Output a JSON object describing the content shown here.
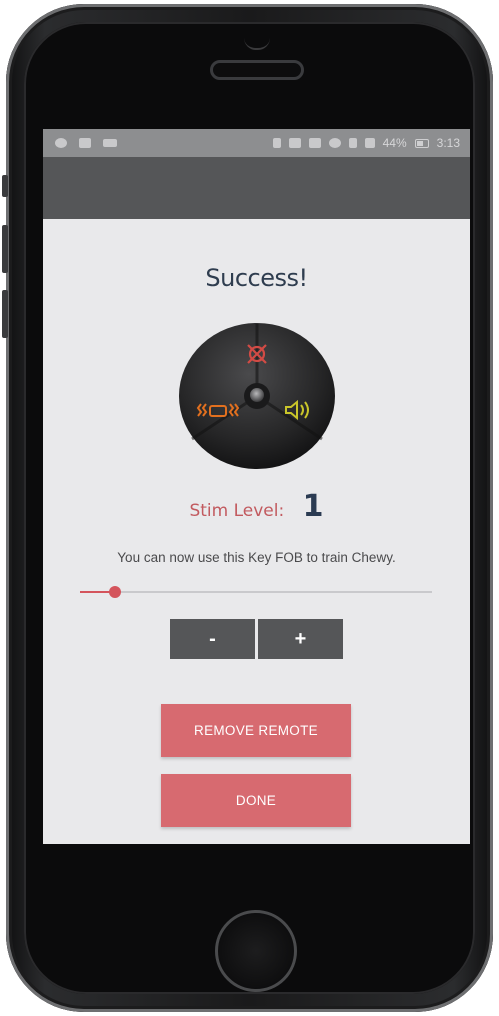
{
  "status_bar": {
    "battery": "44%",
    "time": "3:13"
  },
  "screen": {
    "title": "Success!",
    "stim_label": "Stim Level:",
    "stim_value": "1",
    "info": "You can now use this Key FOB to train Chewy.",
    "slider_level": 0.1,
    "stepper": {
      "minus": "-",
      "plus": "+"
    },
    "remove_button": "REMOVE REMOTE",
    "done_button": "DONE"
  },
  "colors": {
    "accent": "#d4545c",
    "button": "#d76a70",
    "dark_button": "#555658",
    "title_text": "#2f3d4f",
    "fob_stim_icon": "#d24b45",
    "fob_vibrate_icon": "#e2701f",
    "fob_tone_icon": "#c9c52a"
  },
  "icons": {
    "stim": "stim-x-icon",
    "vibrate": "vibrate-icon",
    "tone": "speaker-icon"
  }
}
